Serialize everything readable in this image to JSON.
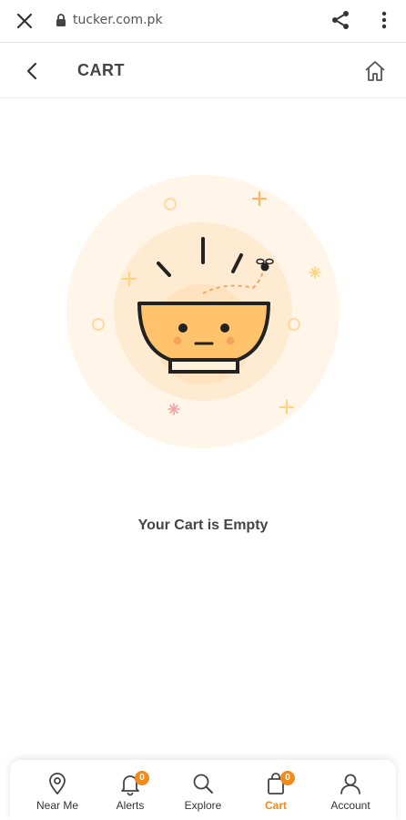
{
  "browser": {
    "url": "tucker.com.pk"
  },
  "header": {
    "title": "CART"
  },
  "main": {
    "empty_message": "Your Cart is Empty"
  },
  "colors": {
    "accent": "#f08c1e",
    "bowl": "#ffc46b",
    "glow": "#fff5e6"
  },
  "bottom_nav": {
    "items": [
      {
        "label": "Near Me",
        "icon": "map-pin-icon"
      },
      {
        "label": "Alerts",
        "icon": "bell-icon",
        "badge": "0"
      },
      {
        "label": "Explore",
        "icon": "search-icon"
      },
      {
        "label": "Cart",
        "icon": "shopping-bag-icon",
        "badge": "0",
        "active": true
      },
      {
        "label": "Account",
        "icon": "user-icon"
      }
    ]
  }
}
